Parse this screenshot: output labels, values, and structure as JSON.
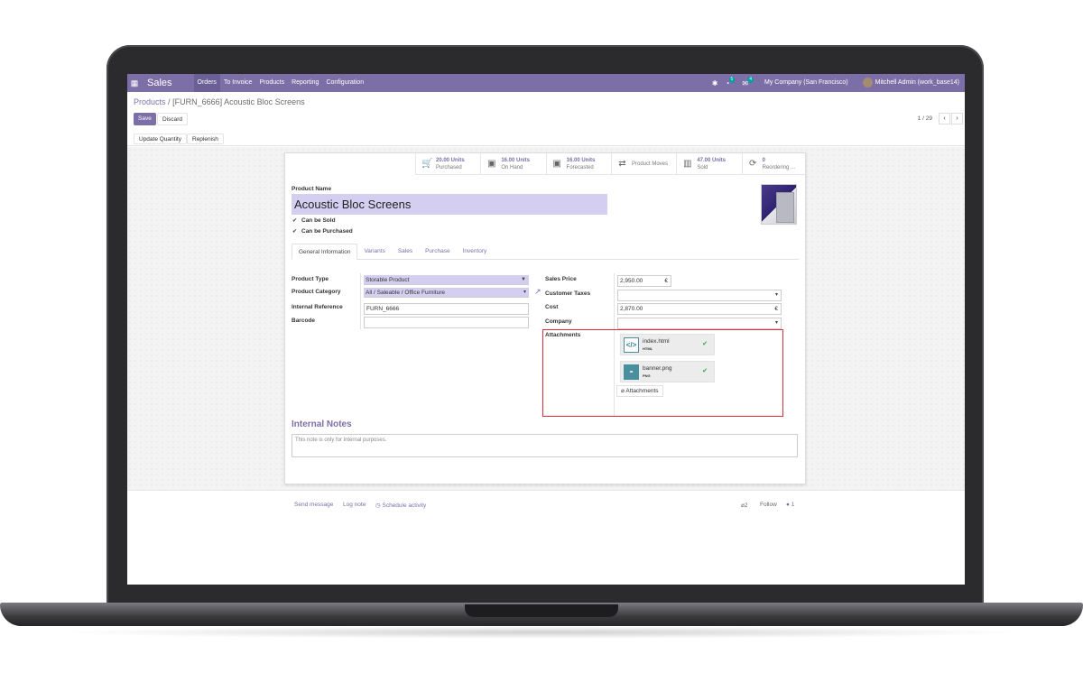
{
  "navbar": {
    "app_name": "Sales",
    "menu": [
      "Orders",
      "To Invoice",
      "Products",
      "Reporting",
      "Configuration"
    ],
    "chat_badge": "4",
    "activity_badge": "5",
    "company": "My Company (San Francisco)",
    "user": "Mitchell Admin (work_base14)"
  },
  "breadcrumb": {
    "parent": "Products",
    "separator": "/",
    "current": "[FURN_6666] Acoustic Bloc Screens"
  },
  "buttons": {
    "save": "Save",
    "discard": "Discard",
    "update_quantity": "Update Quantity",
    "replenish": "Replenish"
  },
  "pager": {
    "text": "1 / 29"
  },
  "stats": [
    {
      "value": "20.00 Units",
      "label": "Purchased",
      "icon": "cart-icon"
    },
    {
      "value": "16.00 Units",
      "label": "On Hand",
      "icon": "cubes-icon"
    },
    {
      "value": "16.00 Units",
      "label": "Forecasted",
      "icon": "cubes-icon"
    },
    {
      "value": "",
      "label": "Product Moves",
      "icon": "exchange-icon"
    },
    {
      "value": "47.00 Units",
      "label": "Sold",
      "icon": "bar-chart-icon"
    },
    {
      "value": "0",
      "label": "Reordering ...",
      "icon": "refresh-icon"
    }
  ],
  "product": {
    "name_label": "Product Name",
    "name": "Acoustic Bloc Screens",
    "can_be_sold": "Can be Sold",
    "can_be_purchased": "Can be Purchased"
  },
  "tabs": [
    "General Information",
    "Variants",
    "Sales",
    "Purchase",
    "Inventory"
  ],
  "fields": {
    "product_type_label": "Product Type",
    "product_type": "Storable Product",
    "product_category_label": "Product Category",
    "product_category": "All / Saleable / Office Furniture",
    "internal_reference_label": "Internal Reference",
    "internal_reference": "FURN_6666",
    "barcode_label": "Barcode",
    "barcode": "",
    "sales_price_label": "Sales Price",
    "sales_price": "2,950.00",
    "currency": "€",
    "customer_taxes_label": "Customer Taxes",
    "cost_label": "Cost",
    "cost": "2,870.00",
    "company_label": "Company",
    "attachments_label": "Attachments"
  },
  "attachments": [
    {
      "name": "index.html",
      "ext": "HTML",
      "icon": "code-file-icon"
    },
    {
      "name": "banner.png",
      "ext": "PNG",
      "icon": "image-file-icon"
    }
  ],
  "attachments_button": "Attachments",
  "notes": {
    "title": "Internal Notes",
    "placeholder": "This note is only for internal purposes."
  },
  "chatter": {
    "send_message": "Send message",
    "log_note": "Log note",
    "schedule_activity": "Schedule activity",
    "attachments_count": "2",
    "follow": "Follow",
    "followers_count": "1"
  }
}
